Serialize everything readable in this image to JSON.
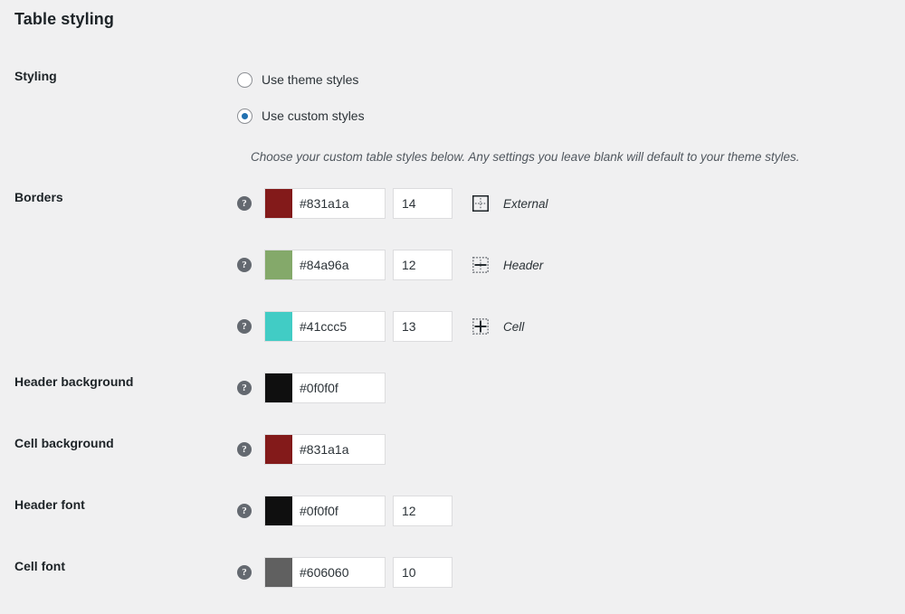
{
  "page": {
    "title": "Table styling",
    "background_color": "#f0f0f1"
  },
  "styling": {
    "label": "Styling",
    "options": [
      {
        "label": "Use theme styles",
        "selected": false
      },
      {
        "label": "Use custom styles",
        "selected": true
      }
    ],
    "accent_color": "#2271b1",
    "description": "Choose your custom table styles below. Any settings you leave blank will default to your theme styles."
  },
  "borders": {
    "label": "Borders",
    "help_glyph": "?",
    "rows": [
      {
        "color": "#831a1a",
        "color_value": "#831a1a",
        "width_value": "14",
        "icon": "border-external-icon",
        "type_label": "External"
      },
      {
        "color": "#84a96a",
        "color_value": "#84a96a",
        "width_value": "12",
        "icon": "border-header-icon",
        "type_label": "Header"
      },
      {
        "color": "#41ccc5",
        "color_value": "#41ccc5",
        "width_value": "13",
        "icon": "border-cell-icon",
        "type_label": "Cell"
      }
    ]
  },
  "header_background": {
    "label": "Header background",
    "color": "#0f0f0f",
    "color_value": "#0f0f0f"
  },
  "cell_background": {
    "label": "Cell background",
    "color": "#831a1a",
    "color_value": "#831a1a"
  },
  "header_font": {
    "label": "Header font",
    "color": "#0f0f0f",
    "color_value": "#0f0f0f",
    "size_value": "12"
  },
  "cell_font": {
    "label": "Cell font",
    "color": "#606060",
    "color_value": "#606060",
    "size_value": "10"
  }
}
